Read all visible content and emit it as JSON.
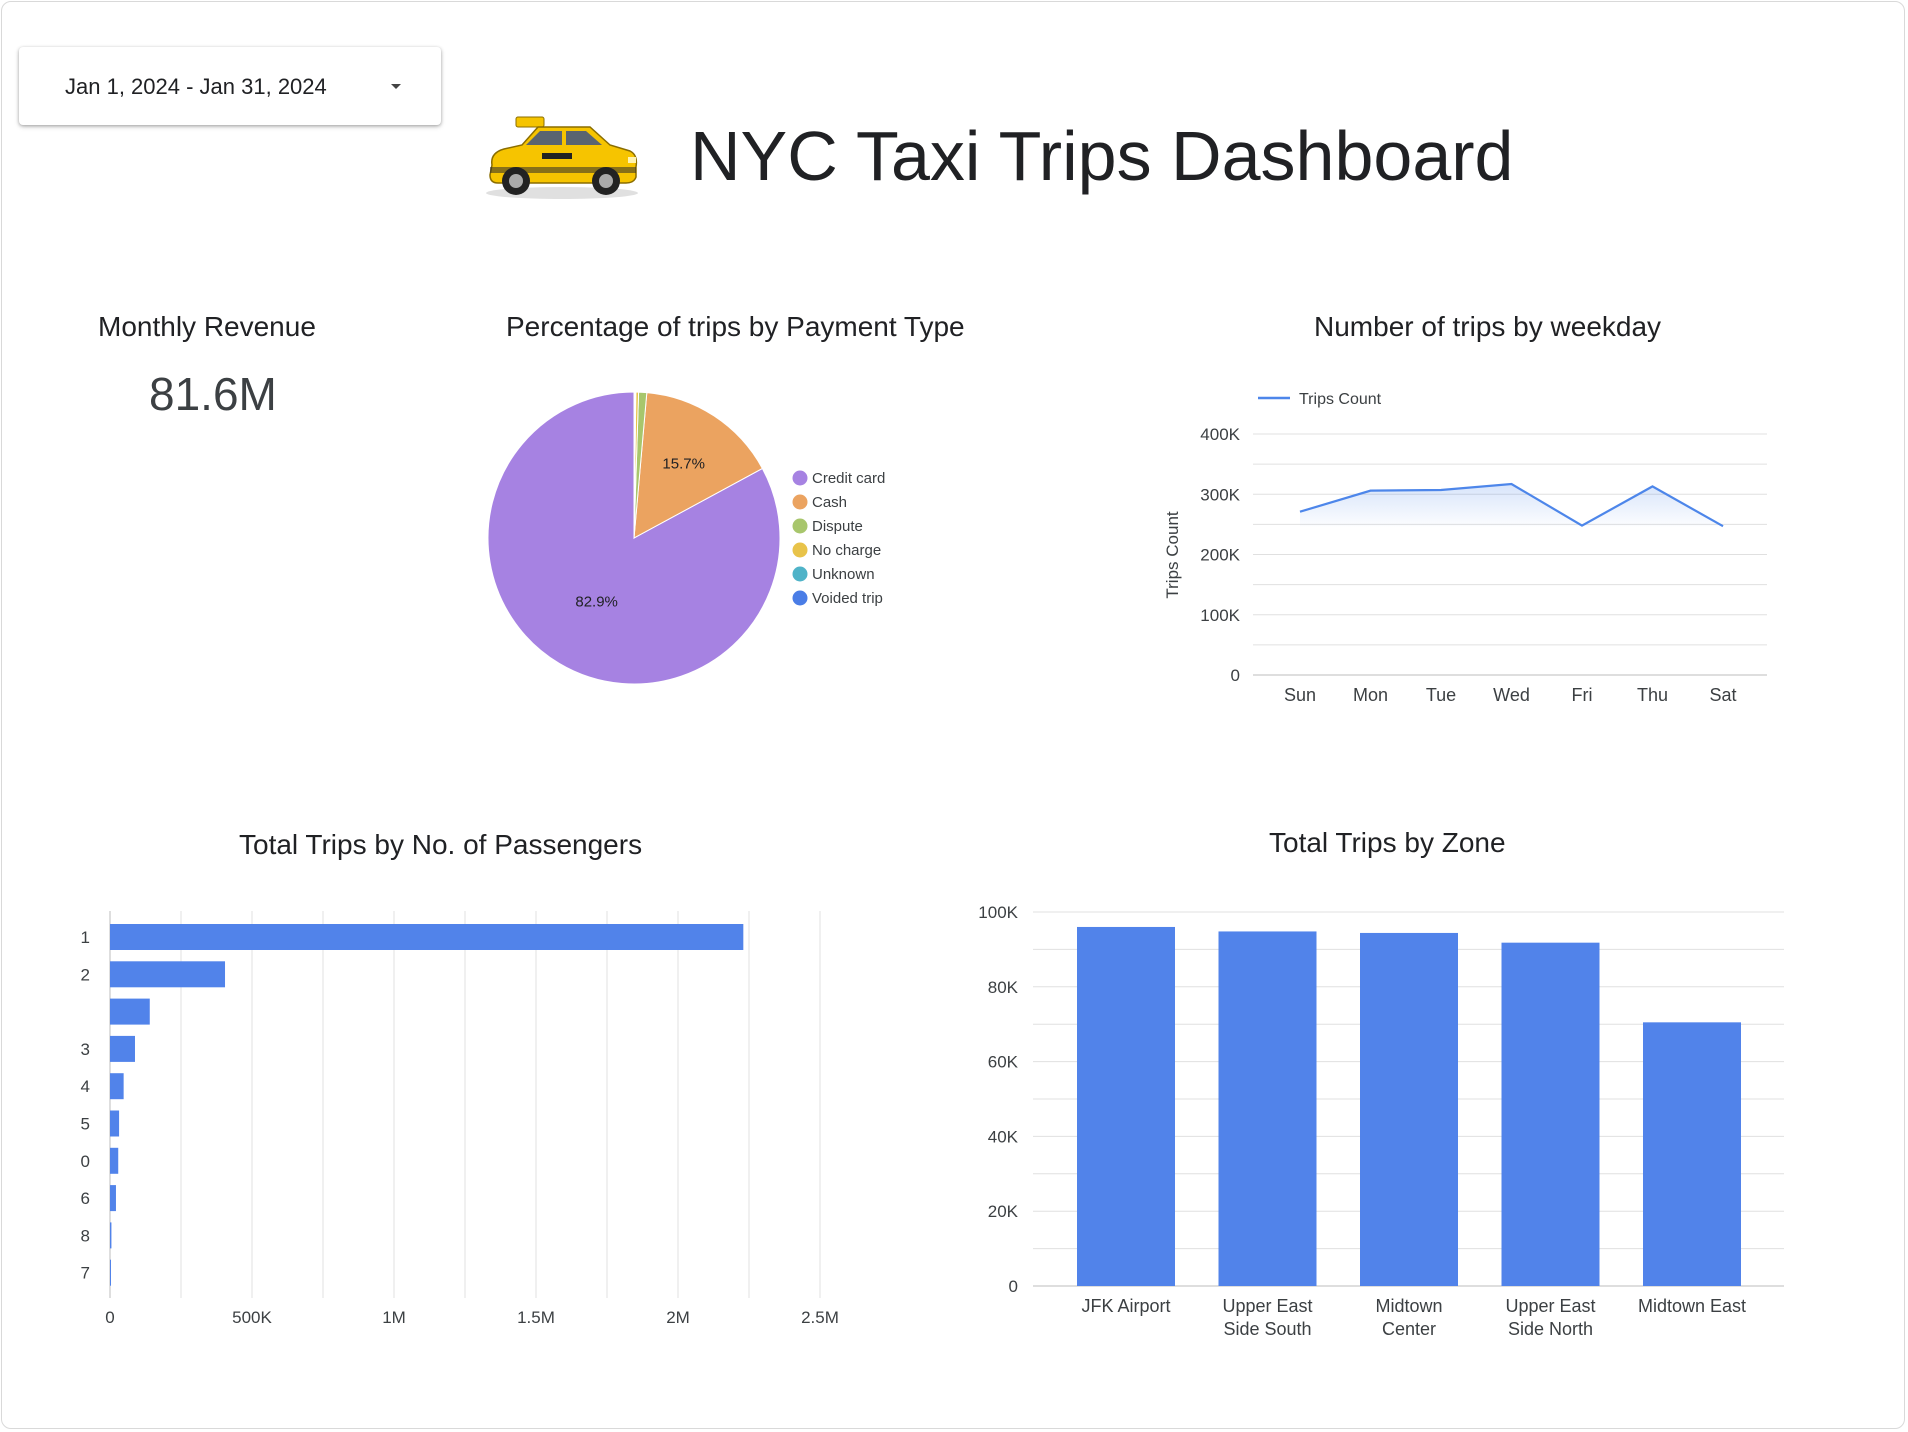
{
  "date_range": {
    "label": "Jan 1, 2024 - Jan 31, 2024",
    "caret_icon": "dropdown-caret-icon"
  },
  "header": {
    "title": "NYC Taxi Trips Dashboard",
    "logo_icon": "taxi-cab-icon"
  },
  "kpi": {
    "title": "Monthly Revenue",
    "value": "81.6M"
  },
  "colors": {
    "bar": "#5183ea",
    "line": "#4d86ea",
    "grid": "#e0e0e0",
    "axis": "#bdbdbd"
  },
  "chart_data": [
    {
      "id": "payment",
      "type": "pie",
      "title": "Percentage of trips by Payment Type",
      "labels": [
        "Credit card",
        "Cash",
        "Dispute",
        "No charge",
        "Unknown",
        "Voided trip"
      ],
      "values": [
        82.9,
        15.7,
        0.9,
        0.3,
        0.1,
        0.1
      ],
      "colors": [
        "#a682e2",
        "#eba360",
        "#a8c66c",
        "#e8c34a",
        "#4fb3c8",
        "#4a7de6"
      ],
      "data_labels": [
        "82.9%",
        "15.7%",
        "",
        "",
        "",
        ""
      ],
      "legend": "right"
    },
    {
      "id": "weekday",
      "type": "line",
      "title": "Number of trips by weekday",
      "categories": [
        "Sun",
        "Mon",
        "Tue",
        "Wed",
        "Fri",
        "Thu",
        "Sat"
      ],
      "series": [
        {
          "name": "Trips Count",
          "values": [
            271000,
            306000,
            307000,
            317000,
            248000,
            313000,
            247000
          ]
        }
      ],
      "ylabel": "Trips Count",
      "yticks": [
        "0",
        "100K",
        "200K",
        "300K",
        "400K"
      ],
      "ylim": [
        0,
        400000
      ],
      "legend": "top-left",
      "grid": true
    },
    {
      "id": "passengers",
      "type": "bar",
      "orientation": "horizontal",
      "title": "Total Trips by No. of Passengers",
      "categories": [
        "1",
        "2",
        "",
        "3",
        "4",
        "5",
        "0",
        "6",
        "8",
        "7"
      ],
      "values": [
        2230000,
        405000,
        140000,
        88000,
        48000,
        32000,
        29000,
        21000,
        5000,
        3000
      ],
      "xticks": [
        "0",
        "500K",
        "1M",
        "1.5M",
        "2M",
        "2.5M"
      ],
      "xlim": [
        0,
        2500000
      ],
      "grid": true
    },
    {
      "id": "zones",
      "type": "bar",
      "title": "Total Trips by Zone",
      "categories": [
        "JFK Airport",
        "Upper East Side South",
        "Midtown Center",
        "Upper East Side North",
        "Midtown East"
      ],
      "category_lines": [
        [
          "JFK Airport"
        ],
        [
          "Upper East",
          "Side South"
        ],
        [
          "Midtown",
          "Center"
        ],
        [
          "Upper East",
          "Side North"
        ],
        [
          "Midtown East"
        ]
      ],
      "values": [
        96000,
        94800,
        94400,
        91800,
        70500
      ],
      "yticks": [
        "0",
        "20K",
        "40K",
        "60K",
        "80K",
        "100K"
      ],
      "ylim": [
        0,
        100000
      ],
      "grid": true
    }
  ]
}
